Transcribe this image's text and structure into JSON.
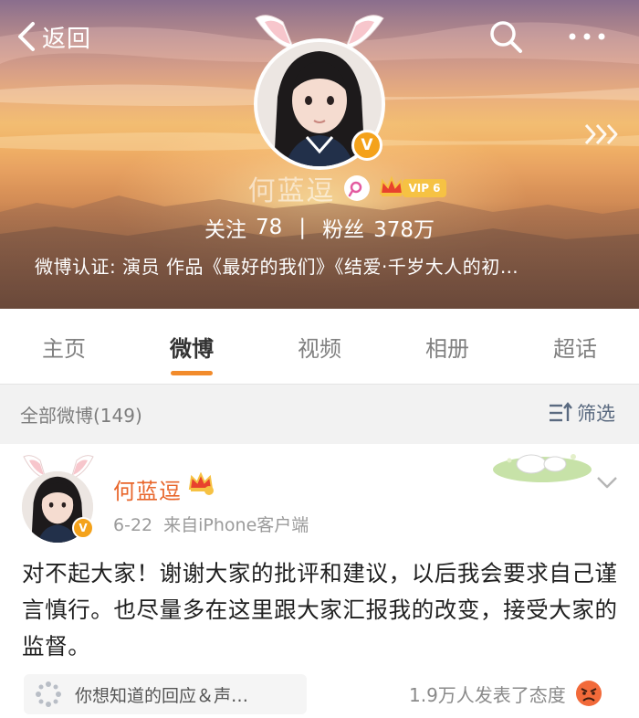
{
  "header": {
    "back_label": "返回",
    "profile_name": "何蓝逗",
    "vip_label": "VIP 6",
    "verified_badge": "V",
    "following_label": "关注",
    "following_count": "78",
    "separator": "|",
    "followers_label": "粉丝",
    "followers_count": "378万",
    "verification": "微博认证: 演员 作品《最好的我们》《结爱·千岁大人的初…"
  },
  "tabs": [
    {
      "label": "主页",
      "active": false
    },
    {
      "label": "微博",
      "active": true
    },
    {
      "label": "视频",
      "active": false
    },
    {
      "label": "相册",
      "active": false
    },
    {
      "label": "超话",
      "active": false
    }
  ],
  "filter": {
    "count_label": "全部微博(149)",
    "filter_label": "筛选"
  },
  "post": {
    "author": "何蓝逗",
    "verified_badge": "V",
    "date": "6-22",
    "source": "来自iPhone客户端",
    "text": "对不起大家！谢谢大家的批评和建议，以后我会要求自己谨言慎行。也尽量多在这里跟大家汇报我的改变，接受大家的监督。",
    "topic_chip": "你想知道的回应＆声…",
    "reactions": "1.9万人发表了态度"
  },
  "colors": {
    "accent_orange": "#f28b2b",
    "name_orange": "#e8662b",
    "verify_gold": "#f4a21b",
    "filter_blue": "#5a6a80"
  },
  "icons": [
    "back-chevron-icon",
    "search-icon",
    "more-icon",
    "triple-chevron-icon",
    "gender-icon",
    "crown-icon",
    "filter-icon",
    "chevron-down-icon",
    "topic-icon",
    "angry-face-icon"
  ]
}
